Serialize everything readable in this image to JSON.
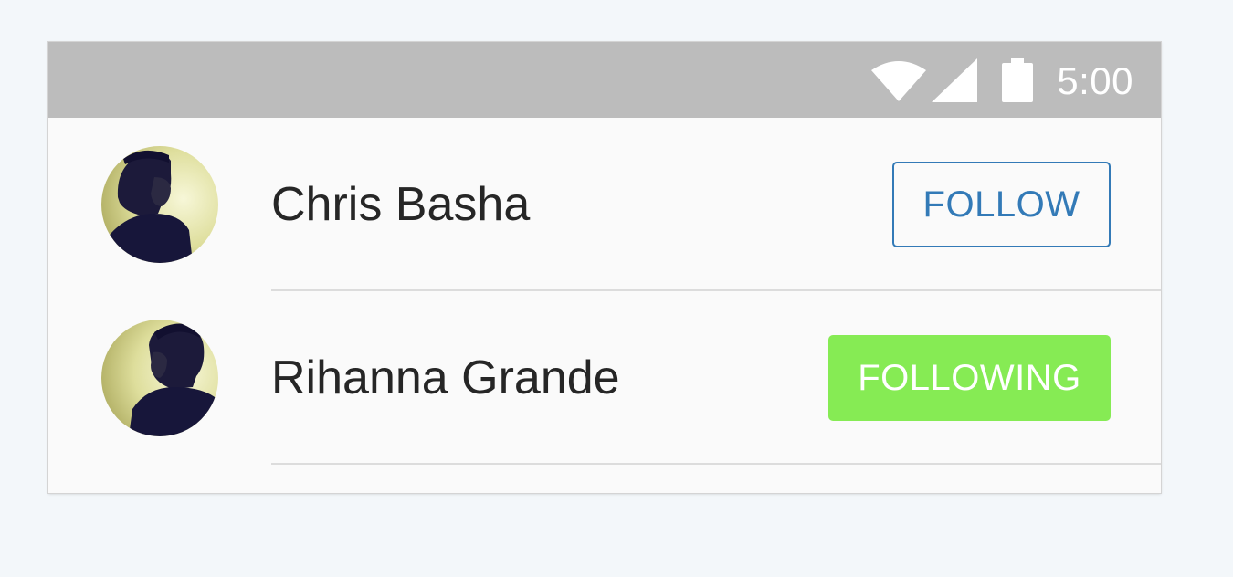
{
  "status_bar": {
    "time": "5:00",
    "icons": [
      "wifi-icon",
      "cellular-signal-icon",
      "battery-icon"
    ]
  },
  "users": [
    {
      "name": "Chris Basha",
      "button_label": "FOLLOW",
      "following": false
    },
    {
      "name": "Rihanna Grande",
      "button_label": "FOLLOWING",
      "following": true
    }
  ],
  "colors": {
    "status_bar_bg": "#bcbcbc",
    "follow_button": "#337ab7",
    "following_button": "#86eb54",
    "divider": "#dcdcdc"
  }
}
